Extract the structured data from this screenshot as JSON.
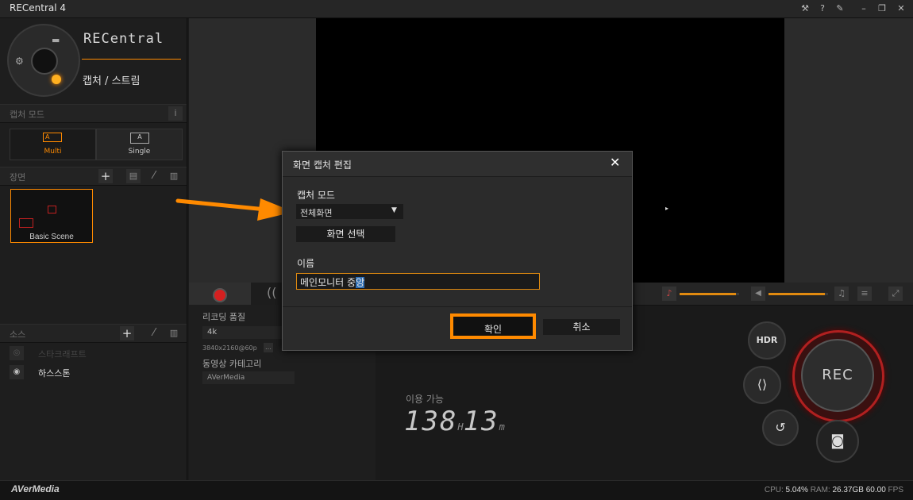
{
  "window": {
    "title": "RECentral 4",
    "controls": [
      "wrench-icon",
      "help-icon",
      "pin-icon",
      "minimize-icon",
      "restore-icon",
      "close-icon"
    ]
  },
  "brand": {
    "logo_text": "RECentral",
    "mode_label": "캡처 / 스트림"
  },
  "sidebar": {
    "capture_mode": {
      "header": "캡처 모드",
      "info": "i",
      "options": [
        {
          "label": "Multi",
          "glyph": "A",
          "selected": true
        },
        {
          "label": "Single",
          "glyph": "A",
          "selected": false
        }
      ]
    },
    "scene": {
      "header": "장면",
      "scenes": [
        {
          "label": "Basic Scene"
        }
      ]
    },
    "source": {
      "header": "소스",
      "items": [
        {
          "label": "스타크래프트",
          "visible": false
        },
        {
          "label": "하스스톤",
          "visible": true
        }
      ]
    }
  },
  "recording": {
    "quality_label": "리코딩 품질",
    "quality_value": "4k",
    "resolution": "3840x2160@60p",
    "category_label": "동영상 카테고리",
    "category_value": "AVerMedia",
    "available_label": "이용 가능",
    "hours": "138",
    "hours_unit": "H",
    "minutes": "13",
    "minutes_unit": "m"
  },
  "controls": {
    "hdr": "HDR",
    "rec": "REC",
    "mic_level": 0.95,
    "speaker_level": 0.95
  },
  "dialog": {
    "title": "화면 캡처 편집",
    "capture_mode_label": "캡처 모드",
    "capture_mode_value": "전체화면",
    "select_screen_button": "화면 선택",
    "name_label": "이름",
    "name_value_main": "메인모니터 중",
    "name_value_selected": "앙",
    "confirm_button": "확인",
    "cancel_button": "취소"
  },
  "status": {
    "footer_brand": "AVerMedia",
    "cpu_label": "CPU:",
    "cpu_value": "5.04%",
    "ram_label": "RAM:",
    "ram_value": "26.37GB",
    "fps_value": "60.00",
    "fps_label": "FPS"
  },
  "colors": {
    "accent": "#ff8a00",
    "rec_red": "#c0392b"
  }
}
